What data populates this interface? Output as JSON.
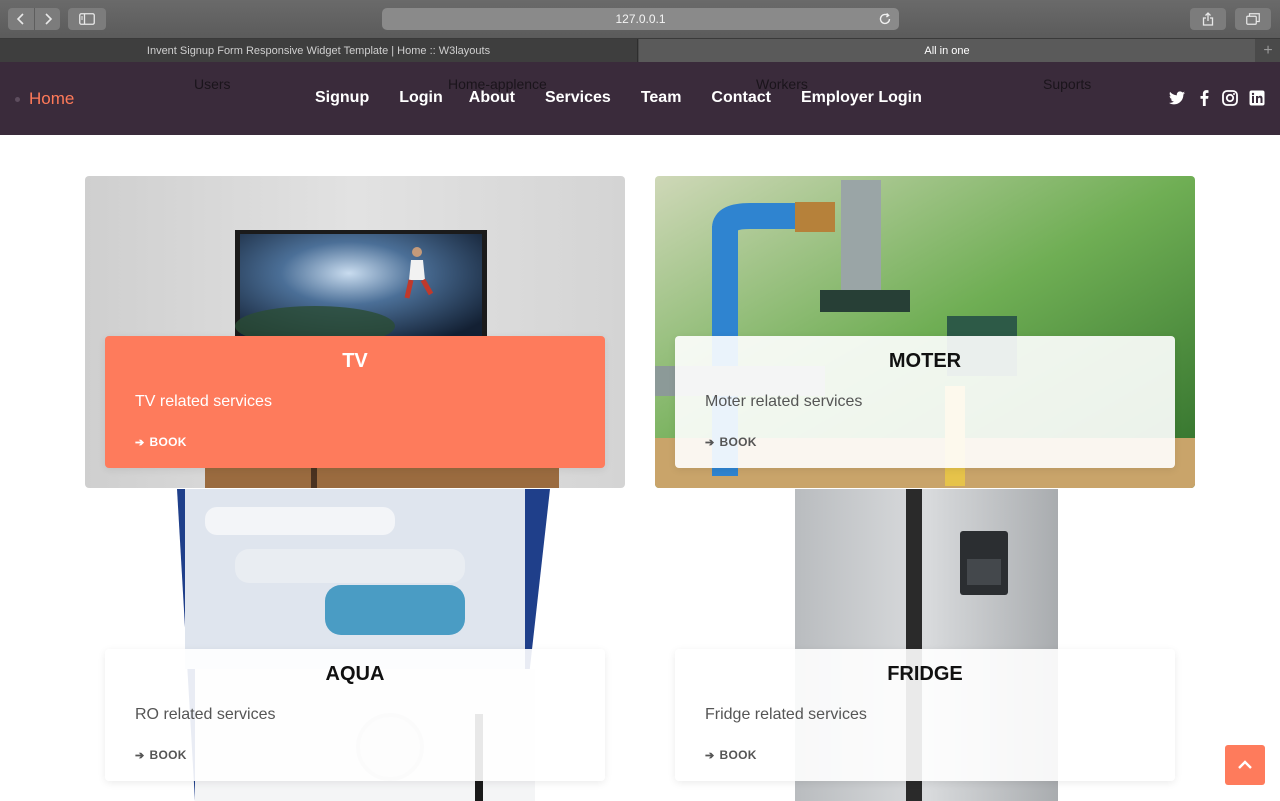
{
  "browser": {
    "address": "127.0.0.1",
    "tabs": [
      {
        "label": "Invent Signup Form Responsive Widget Template | Home :: W3layouts"
      },
      {
        "label": "All in one"
      }
    ],
    "new_tab": "+"
  },
  "header": {
    "ghost_labels": [
      "Users",
      "Home-applence",
      "Workers",
      "Suports"
    ],
    "home": "Home",
    "nav": [
      "Signup",
      "Login",
      "About",
      "Services",
      "Team",
      "Contact",
      "Employer Login"
    ],
    "social_icons": [
      "twitter-icon",
      "facebook-icon",
      "instagram-icon",
      "linkedin-icon"
    ]
  },
  "services": [
    {
      "title": "TV",
      "description": "TV related services",
      "action": "BOOK",
      "highlighted": true
    },
    {
      "title": "MOTER",
      "description": "Moter related services",
      "action": "BOOK",
      "highlighted": false
    },
    {
      "title": "AQUA",
      "description": "RO related services",
      "action": "BOOK",
      "highlighted": false
    },
    {
      "title": "FRIDGE",
      "description": "Fridge related services",
      "action": "BOOK",
      "highlighted": false
    }
  ],
  "colors": {
    "accent": "#fe7b5c",
    "header_bg": "#3a2b3b",
    "home_link": "#ff7a59"
  }
}
